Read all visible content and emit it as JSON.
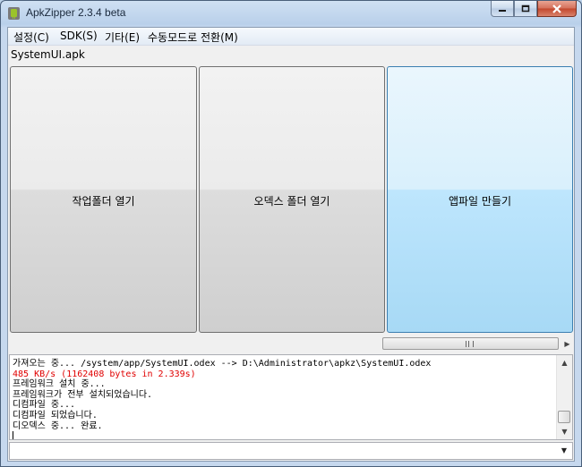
{
  "window": {
    "title": "ApkZipper 2.3.4 beta"
  },
  "menu": [
    {
      "label": "설정(C)"
    },
    {
      "label": "SDK(S)"
    },
    {
      "label": "기타(E)"
    },
    {
      "label": "수동모드로 전환(M)"
    }
  ],
  "file": {
    "name": "SystemUI.apk"
  },
  "buttons": {
    "open_work_folder": "작업폴더 열기",
    "open_odex_folder": "오덱스 폴더 열기",
    "build_apk": "앱파일 만들기"
  },
  "log": [
    {
      "text": "가져오는 중... /system/app/SystemUI.odex --> D:\\Administrator\\apkz\\SystemUI.odex",
      "color": "#000000"
    },
    {
      "text": "485 KB/s (1162408 bytes in 2.339s)",
      "color": "#e00000"
    },
    {
      "text": "프레임워크 설치 중...",
      "color": "#000000"
    },
    {
      "text": "프레임워크가 전부 설치되었습니다.",
      "color": "#000000"
    },
    {
      "text": "디컴파일 중...",
      "color": "#000000"
    },
    {
      "text": "디컴파일 되었습니다.",
      "color": "#000000"
    },
    {
      "text": "디오덱스 중... 완료.",
      "color": "#000000"
    }
  ],
  "colors": {
    "close_button": "#c2462c",
    "highlight_button": "#bee6fd",
    "log_error": "#e00000"
  }
}
